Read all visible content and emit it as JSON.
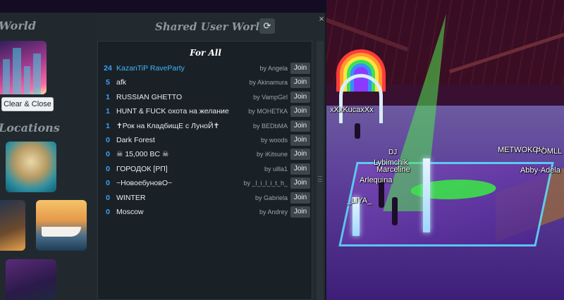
{
  "sidebar": {
    "title": "World",
    "clear_close_label": "Clear & Close",
    "locations_title": "Locations"
  },
  "panel": {
    "title": "Shared User Worlds",
    "close_symbol": "×",
    "refresh_icon": "refresh-icon",
    "refresh_symbol": "⟳",
    "list_header": "For All",
    "join_label": "Join",
    "rows": [
      {
        "count": "24",
        "name": "KazanTiP RaveParty",
        "by": "by  Angela",
        "highlight": true
      },
      {
        "count": "5",
        "name": "afk",
        "by": "by  Akinamura"
      },
      {
        "count": "1",
        "name": "RUSSIAN GHETTO",
        "by": "by  VampGirl"
      },
      {
        "count": "1",
        "name": "HUNT & FUCK охота на желание",
        "by": "by  МОНЕТКА"
      },
      {
        "count": "1",
        "name": "✝Рок на КладбищЕ с ЛуноЙ✝",
        "by": "by  BEDbMA"
      },
      {
        "count": "0",
        "name": "Dark Forest",
        "by": "by  woods"
      },
      {
        "count": "0",
        "name": "☠ 15,000 BC ☠",
        "by": "by  iKitsune"
      },
      {
        "count": "0",
        "name": "ГОРОДОК [РП]",
        "by": "by  ullla1"
      },
      {
        "count": "0",
        "name": "~НовоебуновО~",
        "by": "by  _l_i_l_i_t_h_"
      },
      {
        "count": "0",
        "name": "WINTER",
        "by": "by  Gabriela"
      },
      {
        "count": "0",
        "name": "Moscow",
        "by": "by  Andrey"
      }
    ]
  },
  "scene": {
    "nametags": [
      "xXxKucaxXx",
      "DJ",
      "Lybimchik",
      "Marceline",
      "Arlequina",
      "_LIYA_",
      "METWOKOU",
      "POMLL",
      "Abby-Adela"
    ]
  },
  "colors": {
    "panel_bg": "#222a30",
    "list_bg": "#1a2126",
    "count_blue": "#39a0ff",
    "highlight_blue": "#3fb6ff"
  }
}
